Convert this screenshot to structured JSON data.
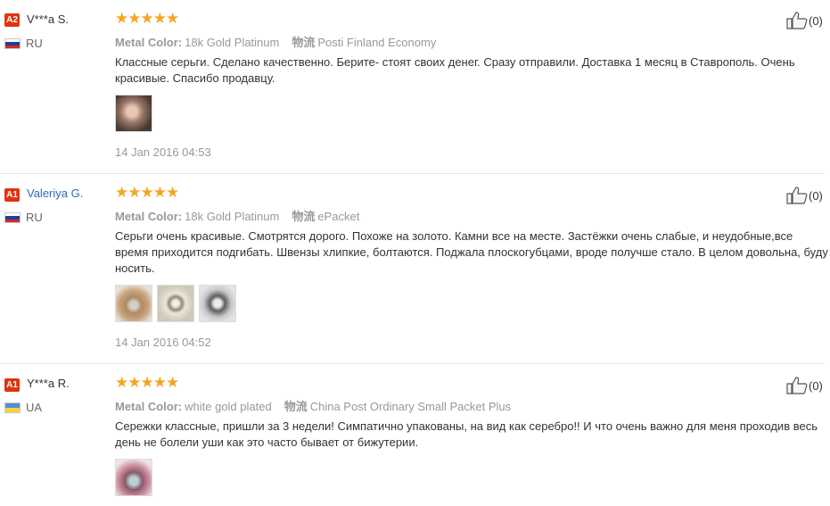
{
  "reviews": [
    {
      "level": "A2",
      "user": "V***a S.",
      "country": "RU",
      "flag": [
        "#ffffff",
        "#1c3ea0",
        "#d52b1e"
      ],
      "stars": "★★★★★",
      "color_label": "Metal Color:",
      "color_value": "18k Gold Platinum",
      "ship_label": "物流",
      "ship_value": "Posti Finland Economy",
      "text": "Классные серьги. Сделано качественно. Берите- стоят своих денег. Сразу отправили. Доставка 1 месяц в Ставрополь. Очень красивые. Спасибо продавцу.",
      "date": "14 Jan 2016 04:53",
      "helpful": "(0)"
    },
    {
      "level": "A1",
      "user": "Valeriya G.",
      "country": "RU",
      "flag": [
        "#ffffff",
        "#1c3ea0",
        "#d52b1e"
      ],
      "stars": "★★★★★",
      "color_label": "Metal Color:",
      "color_value": "18k Gold Platinum",
      "ship_label": "物流",
      "ship_value": "ePacket",
      "text": "Серьги очень красивые. Смотрятся дорого. Похоже на золото. Камни все на месте. Застёжки очень слабые, и неудобные,все время приходится подгибать. Швензы хлипкие, болтаются. Поджала плоскогубцами, вроде получше стало. В целом довольна, буду носить.",
      "date": "14 Jan 2016 04:52",
      "helpful": "(0)"
    },
    {
      "level": "A1",
      "user": "Y***a R.",
      "country": "UA",
      "flag": [
        "#4f8fdd",
        "#f7d332"
      ],
      "stars": "★★★★★",
      "color_label": "Metal Color:",
      "color_value": "white gold plated",
      "ship_label": "物流",
      "ship_value": "China Post Ordinary Small Packet Plus",
      "text": "Сережки классные, пришли за 3 недели! Симпатично упакованы, на вид как серебро!! И что очень важно для меня проходив весь день не болели уши как это часто бывает от бижутерии.",
      "helpful": "(0)"
    }
  ]
}
